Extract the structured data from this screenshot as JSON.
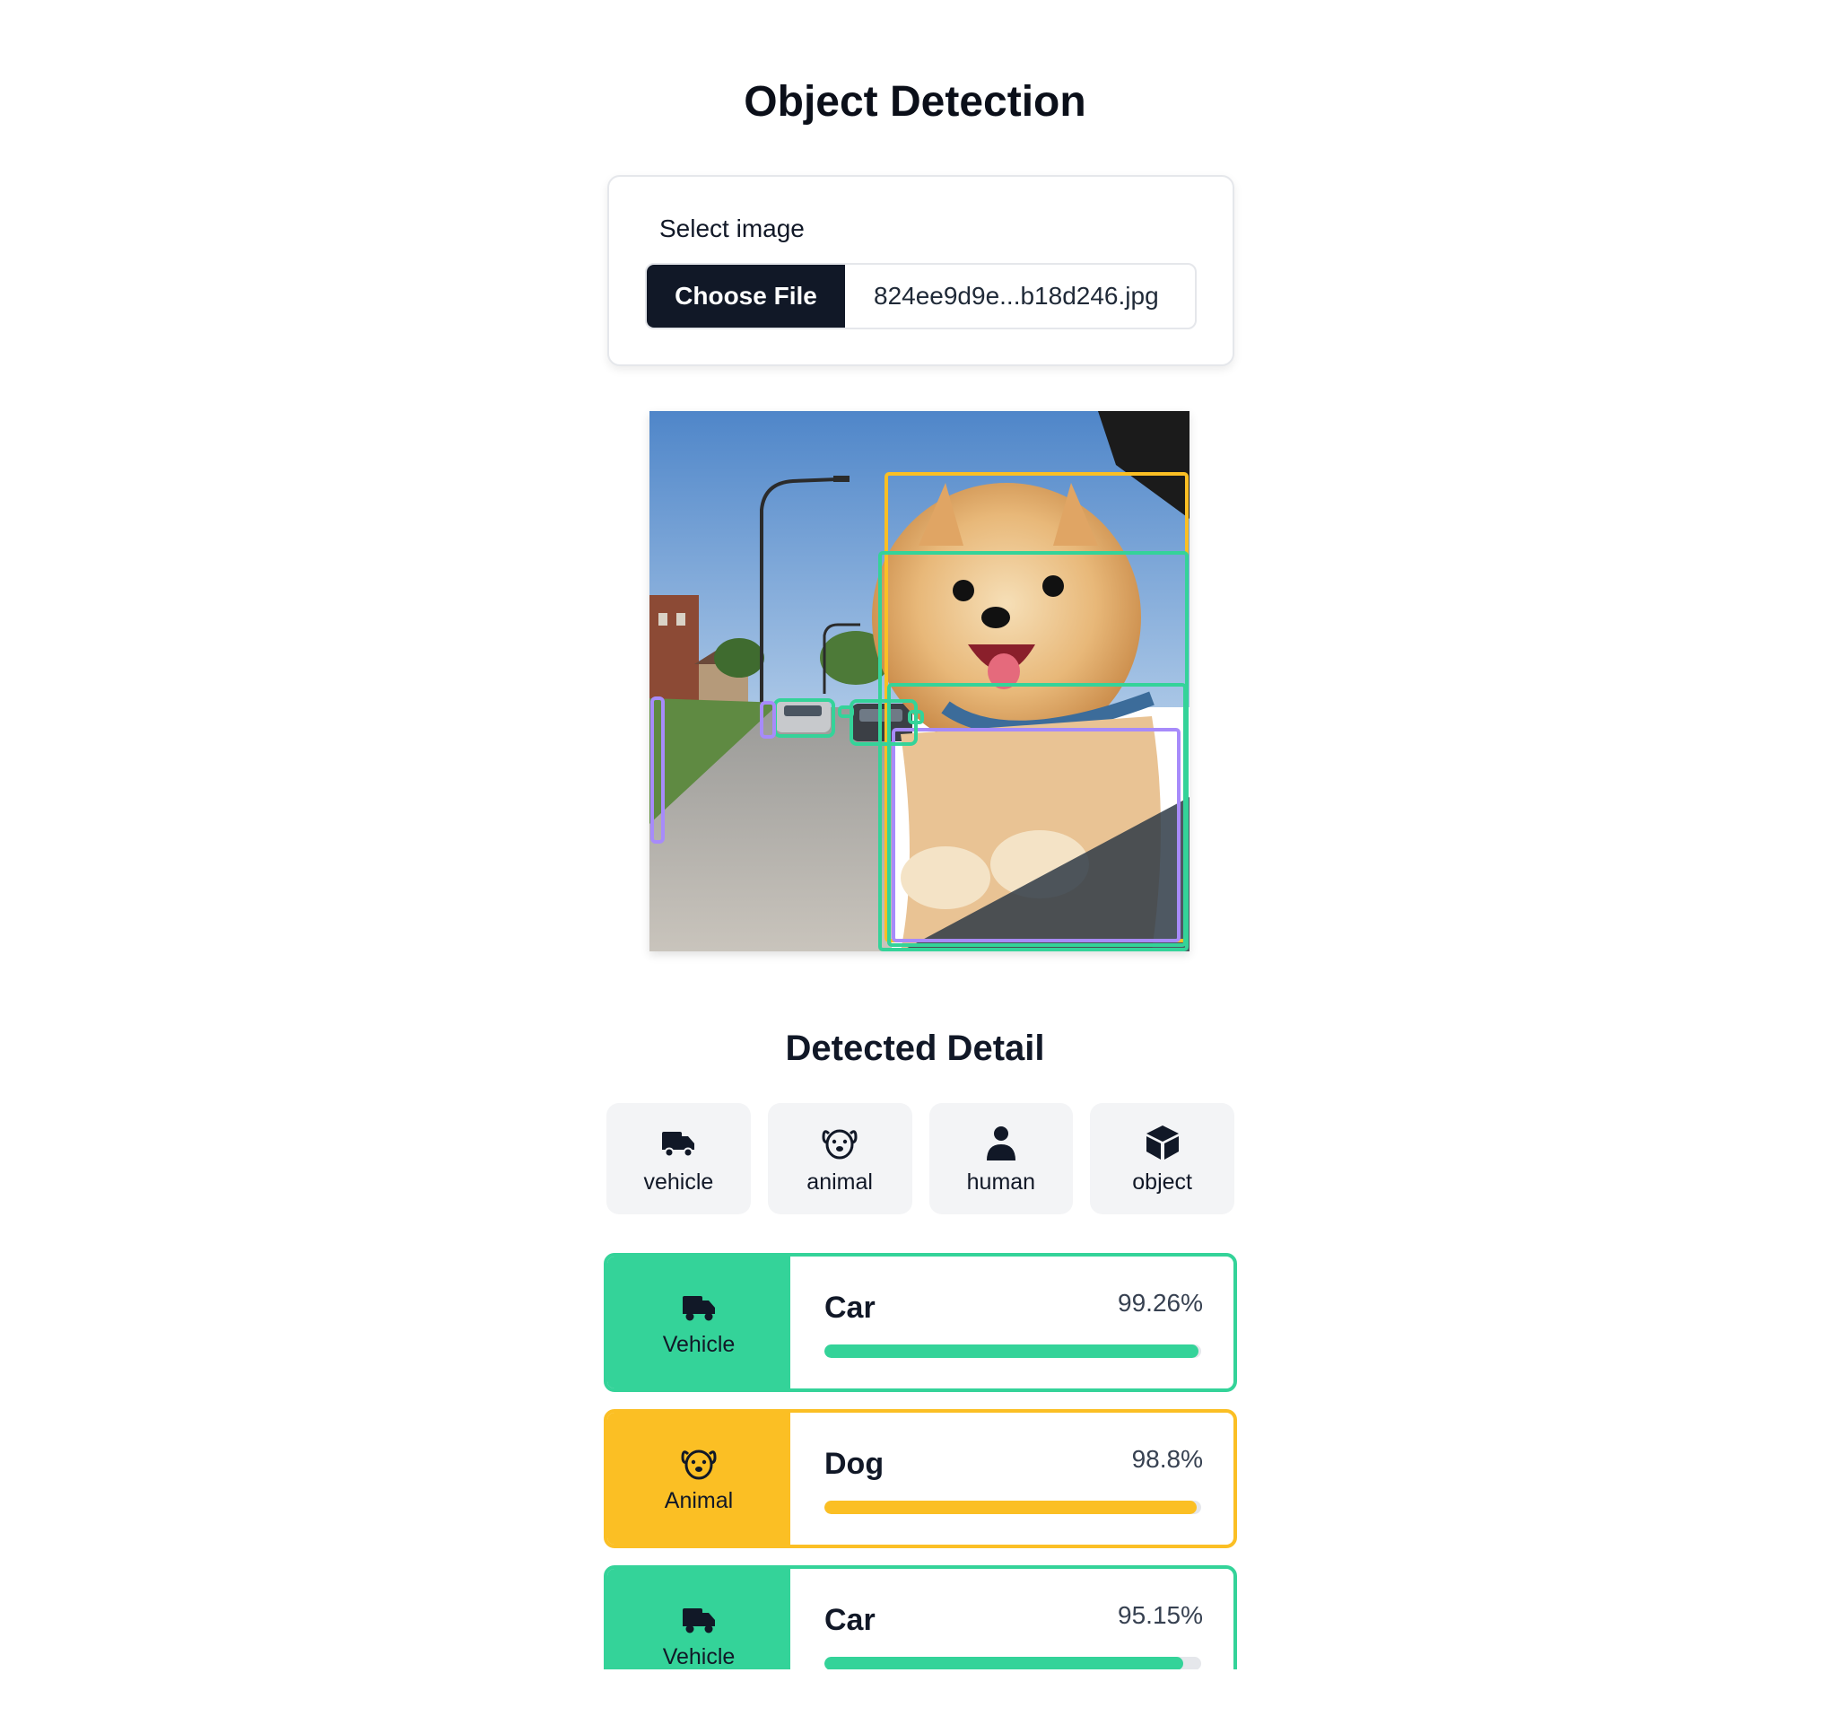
{
  "page": {
    "title": "Object Detection",
    "detail_title": "Detected Detail"
  },
  "upload": {
    "label": "Select image",
    "button_label": "Choose File",
    "file_name": "824ee9d9e...b18d246.jpg"
  },
  "colors": {
    "vehicle": "#34d399",
    "animal": "#fbbf24",
    "human": "#a78bfa",
    "dark": "#111827"
  },
  "filters": [
    {
      "label": "vehicle",
      "icon": "truck-icon"
    },
    {
      "label": "animal",
      "icon": "dog-icon"
    },
    {
      "label": "human",
      "icon": "person-icon"
    },
    {
      "label": "object",
      "icon": "cube-icon"
    }
  ],
  "results": [
    {
      "category": "Vehicle",
      "icon": "truck-icon",
      "name": "Car",
      "confidence_text": "99.26%",
      "confidence": 0.9926,
      "color": "#34d399"
    },
    {
      "category": "Animal",
      "icon": "dog-icon",
      "name": "Dog",
      "confidence_text": "98.8%",
      "confidence": 0.988,
      "color": "#fbbf24"
    },
    {
      "category": "Vehicle",
      "icon": "truck-icon",
      "name": "Car",
      "confidence_text": "95.15%",
      "confidence": 0.9515,
      "color": "#34d399"
    }
  ]
}
